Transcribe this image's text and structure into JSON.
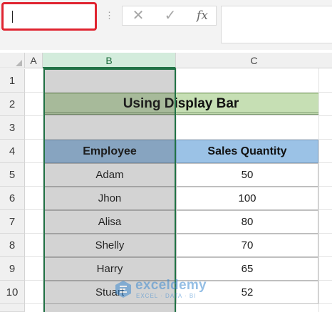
{
  "name_box": {
    "value": ""
  },
  "formula_bar": {
    "separator": "⋮",
    "cancel_label": "✕",
    "enter_label": "✓",
    "fx_label": "fx",
    "value": ""
  },
  "columns": [
    "A",
    "B",
    "C"
  ],
  "rows": [
    "1",
    "2",
    "3",
    "4",
    "5",
    "6",
    "7",
    "8",
    "9",
    "10"
  ],
  "title": "Using Display Bar",
  "table": {
    "headers": [
      "Employee",
      "Sales Quantity"
    ],
    "rows": [
      [
        "Adam",
        "50"
      ],
      [
        "Jhon",
        "100"
      ],
      [
        "Alisa",
        "80"
      ],
      [
        "Shelly",
        "70"
      ],
      [
        "Harry",
        "65"
      ],
      [
        "Stuart",
        "52"
      ]
    ]
  },
  "selection": {
    "column": "B"
  },
  "watermark": {
    "name": "exceldemy",
    "tagline": "EXCEL · DATA · BI"
  },
  "colors": {
    "accent_green": "#217346",
    "name_box_highlight": "#e02430",
    "title_fill": "#c6dfb4",
    "header_fill": "#9bc2e6"
  }
}
